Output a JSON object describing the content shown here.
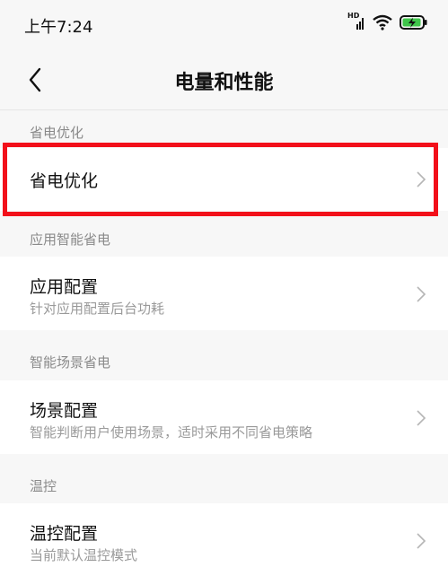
{
  "status_bar": {
    "time": "上午7:24",
    "icons": [
      "hd-signal-icon",
      "wifi-icon",
      "battery-charging-icon"
    ],
    "hd_label": "HD"
  },
  "nav": {
    "title": "电量和性能",
    "back_icon": "chevron-left-icon"
  },
  "sections": [
    {
      "label": "省电优化",
      "rows": [
        {
          "title": "省电优化",
          "subtitle": ""
        }
      ]
    },
    {
      "label": "应用智能省电",
      "rows": [
        {
          "title": "应用配置",
          "subtitle": "针对应用配置后台功耗"
        }
      ]
    },
    {
      "label": "智能场景省电",
      "rows": [
        {
          "title": "场景配置",
          "subtitle": "智能判断用户使用场景，适时采用不同省电策略"
        }
      ]
    },
    {
      "label": "温控",
      "rows": [
        {
          "title": "温控配置",
          "subtitle": "当前默认温控模式"
        }
      ]
    }
  ],
  "colors": {
    "highlight": "#f2101a",
    "background": "#f7f7f7",
    "row_background": "#ffffff",
    "section_label": "#8a8a8a",
    "subtitle": "#9a9a9a"
  }
}
